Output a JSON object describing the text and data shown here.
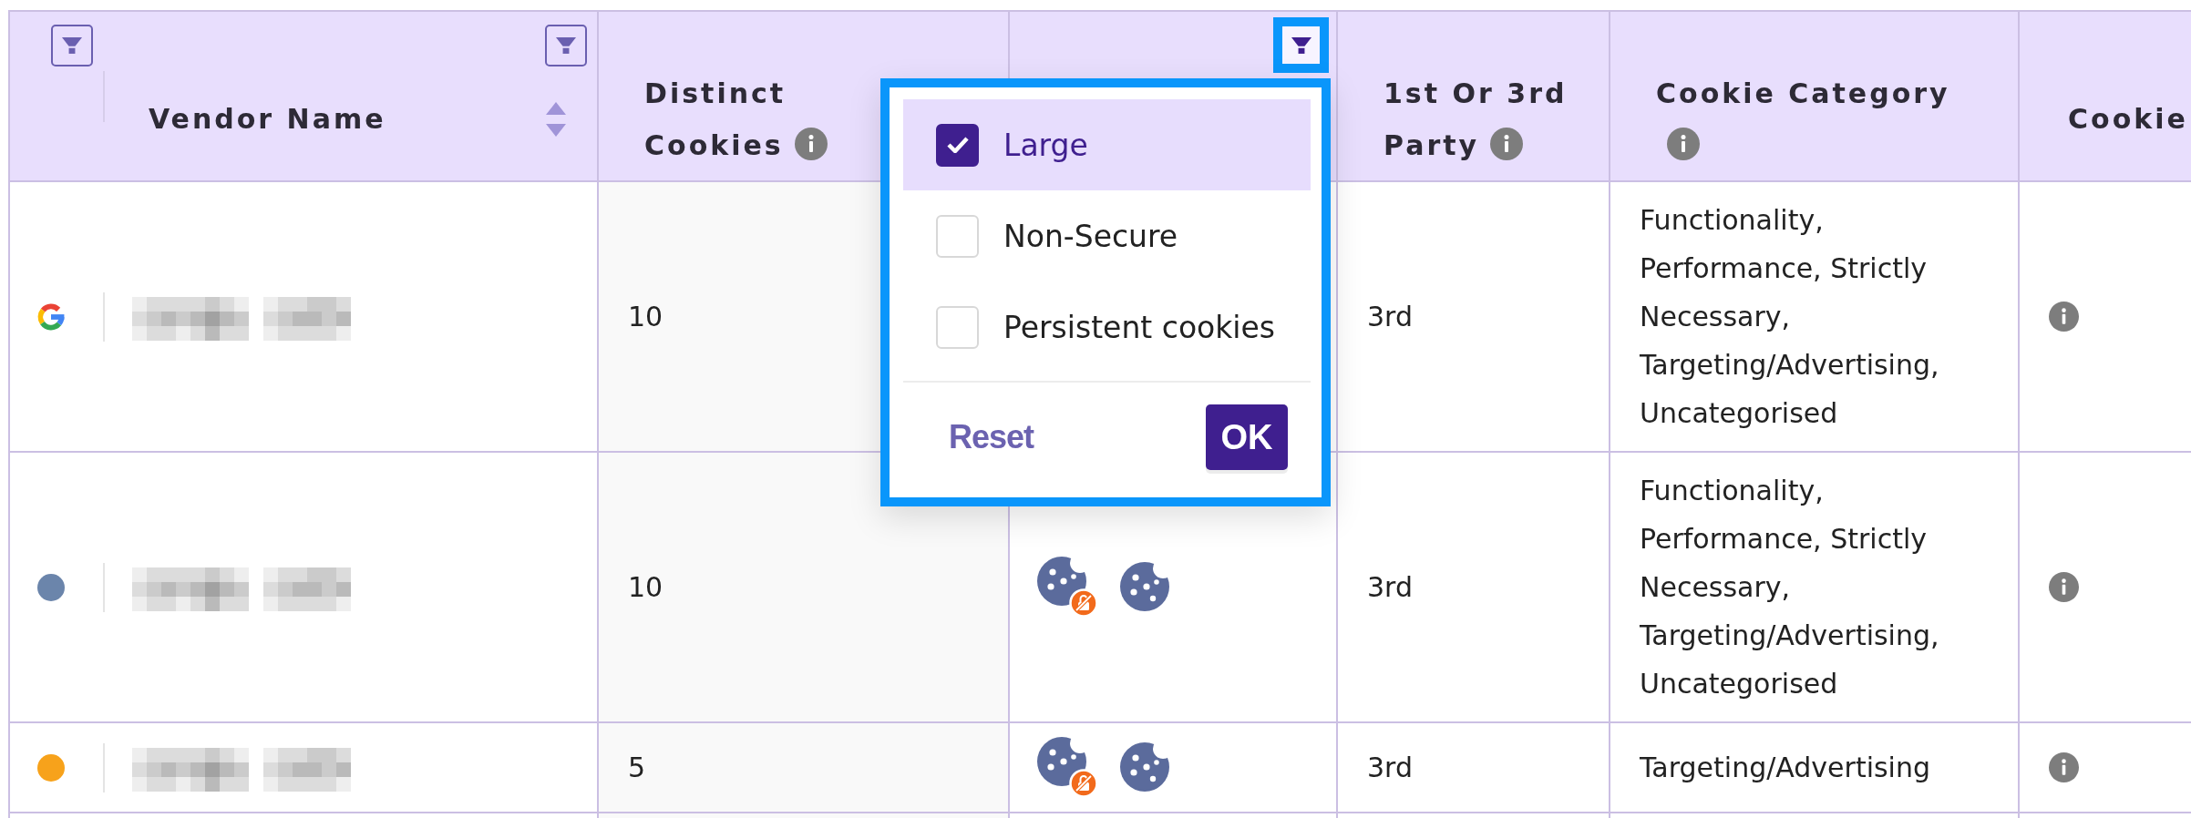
{
  "table": {
    "columns": [
      {
        "filter_button": {
          "active": false,
          "focused": false
        }
      },
      {
        "label": "Vendor Name",
        "filter_button": {
          "active": false,
          "focused": false
        },
        "sortable": true
      },
      {
        "label": "Distinct Cookies",
        "info": true,
        "highlighted": true
      },
      {
        "filter_button": {
          "active": true,
          "focused": true
        }
      },
      {
        "label": "1st Or 3rd Party",
        "info": true
      },
      {
        "label": "Cookie Category",
        "info": true
      },
      {
        "label": "Cookie"
      }
    ],
    "rows": [
      {
        "marker": {
          "kind": "logo"
        },
        "distinct_cookies": "10",
        "party": "3rd",
        "cookie_category": "Functionality, Performance, Strictly Necessary, Targeting/Advertising, Uncategorised",
        "info": true
      },
      {
        "marker": {
          "kind": "dot",
          "color": "#6b85ab"
        },
        "distinct_cookies": "10",
        "cookie_flags": [
          {
            "kind": "badge"
          },
          {
            "kind": "plain"
          }
        ],
        "party": "3rd",
        "cookie_category": "Functionality, Performance, Strictly Necessary, Targeting/Advertising, Uncategorised",
        "info": true
      },
      {
        "marker": {
          "kind": "dot",
          "color": "#f7a21b"
        },
        "distinct_cookies": "5",
        "cookie_flags": [
          {
            "kind": "badge"
          },
          {
            "kind": "plain"
          }
        ],
        "party": "3rd",
        "cookie_category": "Targeting/Advertising",
        "info": true
      }
    ]
  },
  "filter_menu": {
    "focused": true,
    "options": [
      {
        "label": "Large",
        "checked": true
      },
      {
        "label": "Non-Secure",
        "checked": false
      },
      {
        "label": "Persistent cookies",
        "checked": false
      }
    ],
    "reset": "Reset",
    "ok": "OK"
  }
}
